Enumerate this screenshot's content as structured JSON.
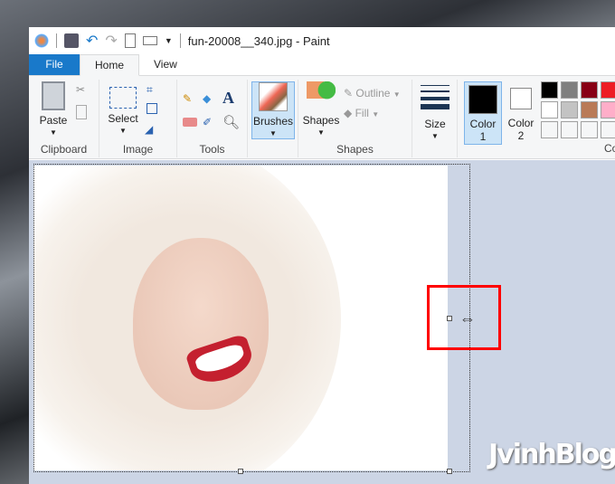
{
  "window": {
    "title": "fun-20008__340.jpg - Paint"
  },
  "tabs": [
    {
      "label": "File"
    },
    {
      "label": "Home"
    },
    {
      "label": "View"
    }
  ],
  "ribbon": {
    "clipboard": {
      "label": "Clipboard",
      "paste": "Paste"
    },
    "image": {
      "label": "Image",
      "select": "Select"
    },
    "tools": {
      "label": "Tools"
    },
    "brushes": {
      "label": "Brushes"
    },
    "shapes": {
      "label": "Shapes",
      "shapes_btn": "Shapes",
      "outline": "Outline",
      "fill": "Fill"
    },
    "size": {
      "label": "Size"
    },
    "color1": {
      "line1": "Color",
      "line2": "1"
    },
    "color2": {
      "line1": "Color",
      "line2": "2"
    },
    "colors": {
      "label": "Co",
      "palette": [
        "#000000",
        "#7f7f7f",
        "#880015",
        "#ed1c24",
        "#ffffff",
        "#c3c3c3",
        "#b97a57",
        "#ffaec9"
      ]
    }
  },
  "watermark": "JvinhBlog",
  "accent": "#1979ca",
  "highlight": "#ff0000"
}
